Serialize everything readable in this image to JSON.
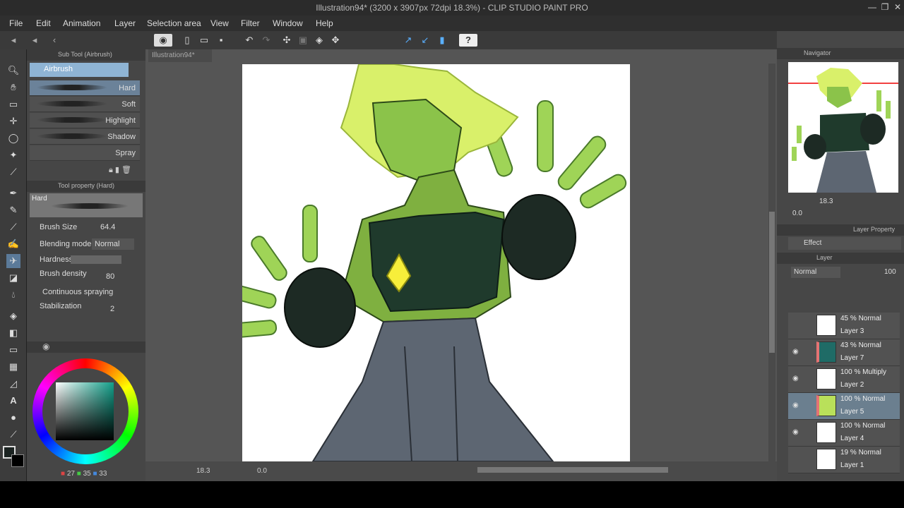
{
  "window": {
    "title": "Illustration94* (3200 x 3907px 72dpi 18.3%) - CLIP STUDIO PAINT PRO"
  },
  "menu": [
    "File",
    "Edit",
    "Animation",
    "Layer",
    "Selection area",
    "View",
    "Filter",
    "Window",
    "Help"
  ],
  "subtool": {
    "header": "Sub Tool (Airbrush)",
    "group": "Airbrush",
    "brushes": [
      "Hard",
      "Soft",
      "Highlight",
      "Shadow",
      "Spray"
    ]
  },
  "tool_property": {
    "header": "Tool property (Hard)",
    "preview_label": "Hard",
    "brush_size_label": "Brush Size",
    "brush_size_value": "64.4",
    "blending_label": "Blending mode",
    "blending_value": "Normal",
    "hardness_label": "Hardness",
    "density_label": "Brush density",
    "density_value": "80",
    "continuous_label": "Continuous spraying",
    "stabilization_label": "Stabilization",
    "stabilization_value": "2"
  },
  "color": {
    "r": "27",
    "g": "35",
    "b": "33",
    "current": "#1b2321"
  },
  "document": {
    "tab": "Illustration94*",
    "zoom": "18.3",
    "angle": "0.0"
  },
  "navigator": {
    "label": "Navigator",
    "zoom": "18.3",
    "angle": "0.0"
  },
  "layer_property": {
    "label": "Layer Property",
    "effect": "Effect"
  },
  "layer_panel": {
    "label": "Layer",
    "blend": "Normal",
    "opacity": "100",
    "layers": [
      {
        "mode": "45 % Normal",
        "name": "Layer 3",
        "visible": false,
        "thumb": "#ffffff"
      },
      {
        "mode": "43 % Normal",
        "name": "Layer 7",
        "visible": true,
        "thumb": "#1f6b66"
      },
      {
        "mode": "100 % Multiply",
        "name": "Layer 2",
        "visible": true,
        "thumb": "#ffffff"
      },
      {
        "mode": "100 % Normal",
        "name": "Layer 5",
        "visible": true,
        "thumb": "#b9e05a",
        "selected": true
      },
      {
        "mode": "100 % Normal",
        "name": "Layer 4",
        "visible": true,
        "thumb": "#ffffff"
      },
      {
        "mode": "19 % Normal",
        "name": "Layer 1",
        "visible": false,
        "thumb": "#ffffff"
      }
    ]
  }
}
